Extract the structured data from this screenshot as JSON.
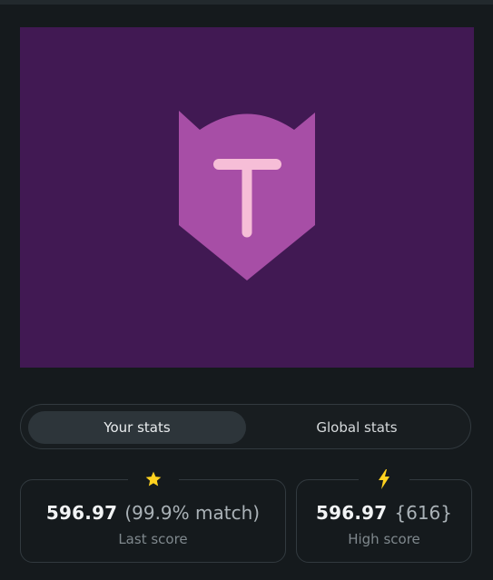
{
  "art": {
    "background": "#411953",
    "shield_color": "#a74ea6",
    "letter": "T",
    "letter_color": "#f6bed7"
  },
  "stats_toggle": {
    "your_stats_label": "Your stats",
    "global_stats_label": "Global stats",
    "active": "your_stats"
  },
  "last_score": {
    "icon": "star-icon",
    "icon_color": "#ffd21f",
    "value": "596.97",
    "match": "(99.9% match)",
    "caption": "Last score"
  },
  "high_score": {
    "icon": "lightning-icon",
    "icon_color": "#ffd21f",
    "value": "596.97",
    "extra": "{616}",
    "caption": "High score"
  }
}
